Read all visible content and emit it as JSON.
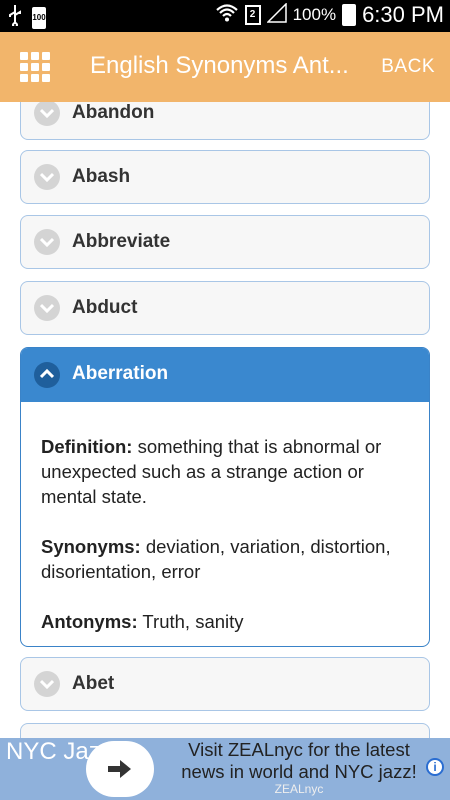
{
  "status_bar": {
    "battery_small": "100",
    "sim_slot": "2",
    "battery_percent": "100%",
    "time": "6:30 PM"
  },
  "header": {
    "title": "English Synonyms Ant...",
    "back_label": "BACK"
  },
  "list": {
    "items": [
      {
        "label": "Abandon"
      },
      {
        "label": "Abash"
      },
      {
        "label": "Abbreviate"
      },
      {
        "label": "Abduct"
      }
    ],
    "expanded": {
      "label": "Aberration",
      "definition_label": "Definition:",
      "definition": " something that is abnormal or unexpected such as a strange action or mental state.",
      "synonyms_label": "Synonyms:",
      "synonyms": " deviation, variation, distortion, disorientation, error",
      "antonyms_label": "Antonyms:",
      "antonyms": " Truth, sanity"
    },
    "after": [
      {
        "label": "Abet"
      }
    ]
  },
  "ad": {
    "brand": "NYC Jazz",
    "text": "Visit ZEALnyc for the latest news in world and NYC jazz!",
    "sub": "ZEALnyc",
    "info_icon": "i",
    "accent": "#8fb1db"
  }
}
